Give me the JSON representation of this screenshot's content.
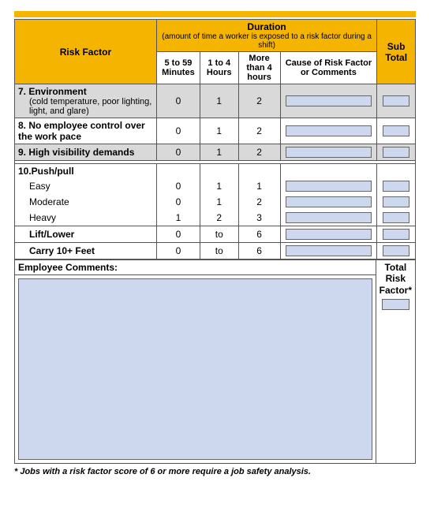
{
  "headers": {
    "risk_factor": "Risk Factor",
    "duration": "Duration",
    "duration_sub": "(amount of time a worker is exposed to a risk factor during a shift)",
    "sub_total": "Sub Total",
    "col1": "5 to 59 Minutes",
    "col2": "1 to 4 Hours",
    "col3": "More than 4 hours",
    "col4": "Cause of Risk Factor or Comments"
  },
  "rows": {
    "r7": {
      "label": "7.  Environment",
      "sub": "(cold temperature, poor lighting, light, and glare)",
      "v1": "0",
      "v2": "1",
      "v3": "2"
    },
    "r8": {
      "label": "8.  No employee control over the work pace",
      "v1": "0",
      "v2": "1",
      "v3": "2"
    },
    "r9": {
      "label": "9.  High visibility demands",
      "v1": "0",
      "v2": "1",
      "v3": "2"
    },
    "r10": {
      "label": "10.Push/pull",
      "easy": {
        "label": "Easy",
        "v1": "0",
        "v2": "1",
        "v3": "1"
      },
      "moderate": {
        "label": "Moderate",
        "v1": "0",
        "v2": "1",
        "v3": "2"
      },
      "heavy": {
        "label": "Heavy",
        "v1": "1",
        "v2": "2",
        "v3": "3"
      }
    },
    "lift": {
      "label": "Lift/Lower",
      "a": "0",
      "mid": "to",
      "b": "6"
    },
    "carry": {
      "label": "Carry 10+ Feet",
      "a": "0",
      "mid": "to",
      "b": "6"
    }
  },
  "comments_label": "Employee Comments:",
  "total_label1": "Total",
  "total_label2": "Risk",
  "total_label3": "Factor*",
  "footnote": "* Jobs with a risk factor score of 6 or more require a job safety analysis."
}
